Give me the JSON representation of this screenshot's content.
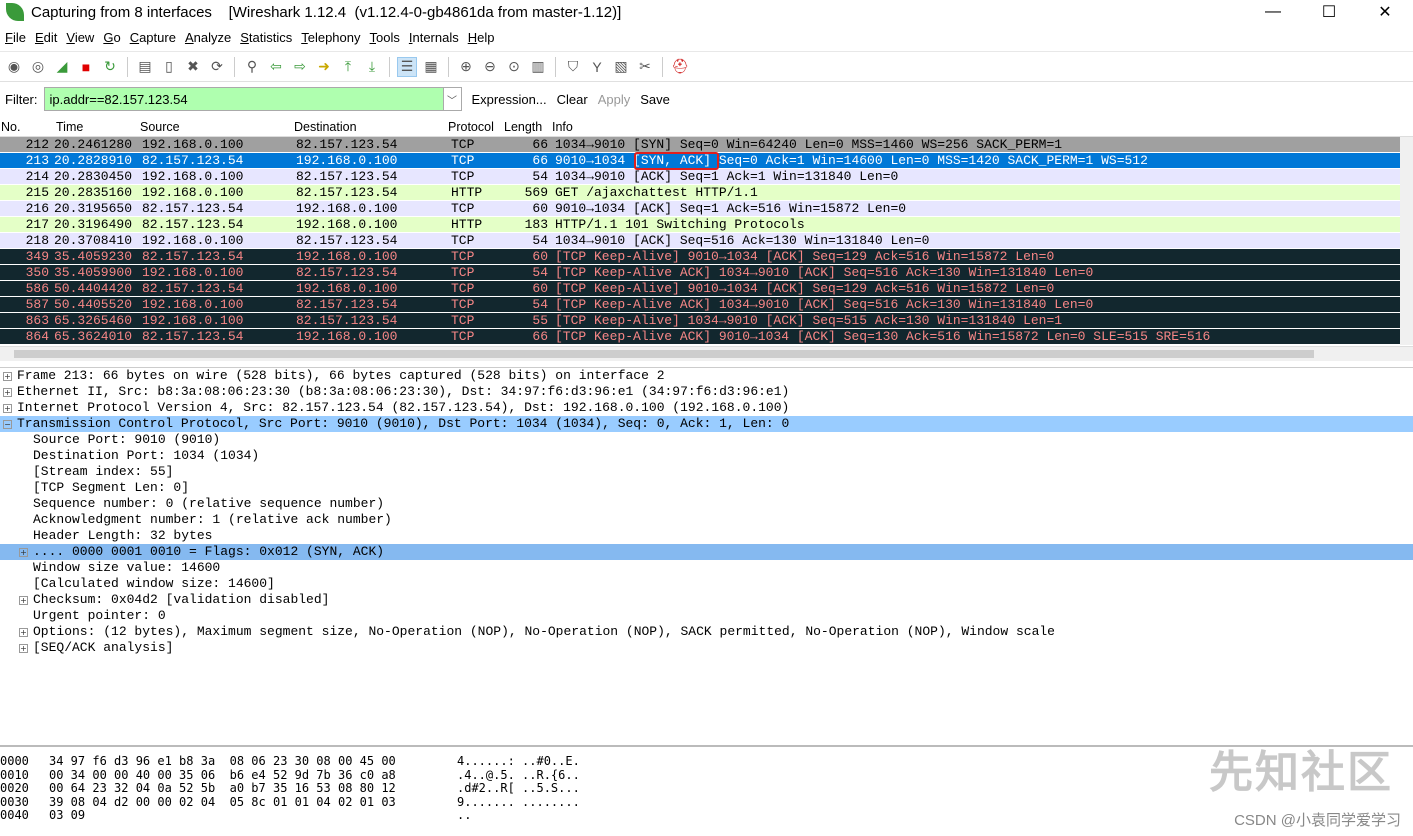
{
  "window": {
    "title": "Capturing from 8 interfaces    [Wireshark 1.12.4  (v1.12.4-0-gb4861da from master-1.12)]"
  },
  "menu": [
    "File",
    "Edit",
    "View",
    "Go",
    "Capture",
    "Analyze",
    "Statistics",
    "Telephony",
    "Tools",
    "Internals",
    "Help"
  ],
  "toolbar": {
    "icons": [
      "interfaces-icon",
      "options-icon",
      "start-capture-icon",
      "stop-capture-icon",
      "restart-capture-icon",
      "|",
      "open-file-icon",
      "save-file-icon",
      "close-file-icon",
      "reload-icon",
      "|",
      "find-icon",
      "back-icon",
      "forward-icon",
      "go-to-packet-icon",
      "first-packet-icon",
      "last-packet-icon",
      "|",
      "colorize-icon",
      "autoscroll-icon",
      "|",
      "zoom-in-icon",
      "zoom-out-icon",
      "normal-size-icon",
      "resize-columns-icon",
      "|",
      "capture-filters-icon",
      "display-filters-icon",
      "coloring-rules-icon",
      "preferences-icon",
      "|",
      "help-icon"
    ]
  },
  "filter": {
    "label": "Filter:",
    "value": "ip.addr==82.157.123.54",
    "expression": "Expression...",
    "clear": "Clear",
    "apply": "Apply",
    "save": "Save"
  },
  "columns": [
    "No.",
    "Time",
    "Source",
    "Destination",
    "Protocol",
    "Length",
    "Info"
  ],
  "colors": {
    "selected": "#0078d7",
    "tcp": "#e7e6ff",
    "http": "#e4ffc7",
    "syn": "#a0a0a0",
    "bad_bg": "#12272e",
    "bad_fg": "#f78787",
    "highlight": "#e0201e"
  },
  "packets": [
    {
      "no": "212",
      "time": "20.2461280",
      "src": "192.168.0.100",
      "dst": "82.157.123.54",
      "proto": "TCP",
      "len": "66",
      "info": "1034→9010 [SYN] Seq=0 Win=64240 Len=0 MSS=1460 WS=256 SACK_PERM=1",
      "style": "syn"
    },
    {
      "no": "213",
      "time": "20.2828910",
      "src": "82.157.123.54",
      "dst": "192.168.0.100",
      "proto": "TCP",
      "len": "66",
      "info": "9010→1034 [SYN, ACK] Seq=0 Ack=1 Win=14600 Len=0 MSS=1420 SACK_PERM=1 WS=512",
      "style": "selected"
    },
    {
      "no": "214",
      "time": "20.2830450",
      "src": "192.168.0.100",
      "dst": "82.157.123.54",
      "proto": "TCP",
      "len": "54",
      "info": "1034→9010 [ACK] Seq=1 Ack=1 Win=131840 Len=0",
      "style": "tcp"
    },
    {
      "no": "215",
      "time": "20.2835160",
      "src": "192.168.0.100",
      "dst": "82.157.123.54",
      "proto": "HTTP",
      "len": "569",
      "info": "GET /ajaxchattest HTTP/1.1",
      "style": "http"
    },
    {
      "no": "216",
      "time": "20.3195650",
      "src": "82.157.123.54",
      "dst": "192.168.0.100",
      "proto": "TCP",
      "len": "60",
      "info": "9010→1034 [ACK] Seq=1 Ack=516 Win=15872 Len=0",
      "style": "tcp"
    },
    {
      "no": "217",
      "time": "20.3196490",
      "src": "82.157.123.54",
      "dst": "192.168.0.100",
      "proto": "HTTP",
      "len": "183",
      "info": "HTTP/1.1 101 Switching Protocols",
      "style": "http"
    },
    {
      "no": "218",
      "time": "20.3708410",
      "src": "192.168.0.100",
      "dst": "82.157.123.54",
      "proto": "TCP",
      "len": "54",
      "info": "1034→9010 [ACK] Seq=516 Ack=130 Win=131840 Len=0",
      "style": "tcp"
    },
    {
      "no": "349",
      "time": "35.4059230",
      "src": "82.157.123.54",
      "dst": "192.168.0.100",
      "proto": "TCP",
      "len": "60",
      "info": "[TCP Keep-Alive] 9010→1034 [ACK] Seq=129 Ack=516 Win=15872 Len=0",
      "style": "bad"
    },
    {
      "no": "350",
      "time": "35.4059900",
      "src": "192.168.0.100",
      "dst": "82.157.123.54",
      "proto": "TCP",
      "len": "54",
      "info": "[TCP Keep-Alive ACK] 1034→9010 [ACK] Seq=516 Ack=130 Win=131840 Len=0",
      "style": "bad"
    },
    {
      "no": "586",
      "time": "50.4404420",
      "src": "82.157.123.54",
      "dst": "192.168.0.100",
      "proto": "TCP",
      "len": "60",
      "info": "[TCP Keep-Alive] 9010→1034 [ACK] Seq=129 Ack=516 Win=15872 Len=0",
      "style": "bad"
    },
    {
      "no": "587",
      "time": "50.4405520",
      "src": "192.168.0.100",
      "dst": "82.157.123.54",
      "proto": "TCP",
      "len": "54",
      "info": "[TCP Keep-Alive ACK] 1034→9010 [ACK] Seq=516 Ack=130 Win=131840 Len=0",
      "style": "bad"
    },
    {
      "no": "863",
      "time": "65.3265460",
      "src": "192.168.0.100",
      "dst": "82.157.123.54",
      "proto": "TCP",
      "len": "55",
      "info": "[TCP Keep-Alive] 1034→9010 [ACK] Seq=515 Ack=130 Win=131840 Len=1",
      "style": "bad"
    },
    {
      "no": "864",
      "time": "65.3624010",
      "src": "82.157.123.54",
      "dst": "192.168.0.100",
      "proto": "TCP",
      "len": "66",
      "info": "[TCP Keep-Alive ACK] 9010→1034 [ACK] Seq=130 Ack=516 Win=15872 Len=0 SLE=515 SRE=516",
      "style": "bad"
    }
  ],
  "details": [
    {
      "text": "Frame 213: 66 bytes on wire (528 bits), 66 bytes captured (528 bits) on interface 2",
      "level": 0,
      "expander": "+"
    },
    {
      "text": "Ethernet II, Src: b8:3a:08:06:23:30 (b8:3a:08:06:23:30), Dst: 34:97:f6:d3:96:e1 (34:97:f6:d3:96:e1)",
      "level": 0,
      "expander": "+"
    },
    {
      "text": "Internet Protocol Version 4, Src: 82.157.123.54 (82.157.123.54), Dst: 192.168.0.100 (192.168.0.100)",
      "level": 0,
      "expander": "+"
    },
    {
      "text": "Transmission Control Protocol, Src Port: 9010 (9010), Dst Port: 1034 (1034), Seq: 0, Ack: 1, Len: 0",
      "level": 0,
      "expander": "-",
      "hl": "#99ccff"
    },
    {
      "text": "Source Port: 9010 (9010)",
      "level": 1
    },
    {
      "text": "Destination Port: 1034 (1034)",
      "level": 1
    },
    {
      "text": "[Stream index: 55]",
      "level": 1
    },
    {
      "text": "[TCP Segment Len: 0]",
      "level": 1
    },
    {
      "text": "Sequence number: 0    (relative sequence number)",
      "level": 1
    },
    {
      "text": "Acknowledgment number: 1    (relative ack number)",
      "level": 1
    },
    {
      "text": "Header Length: 32 bytes",
      "level": 1
    },
    {
      "text": ".... 0000 0001 0010 = Flags: 0x012 (SYN, ACK)",
      "level": 1,
      "expander": "+",
      "hl": "#85b9f0"
    },
    {
      "text": "Window size value: 14600",
      "level": 1
    },
    {
      "text": "[Calculated window size: 14600]",
      "level": 1
    },
    {
      "text": "Checksum: 0x04d2 [validation disabled]",
      "level": 1,
      "expander": "+"
    },
    {
      "text": "Urgent pointer: 0",
      "level": 1
    },
    {
      "text": "Options: (12 bytes), Maximum segment size, No-Operation (NOP), No-Operation (NOP), SACK permitted, No-Operation (NOP), Window scale",
      "level": 1,
      "expander": "+"
    },
    {
      "text": "[SEQ/ACK analysis]",
      "level": 1,
      "expander": "+"
    }
  ],
  "bytes": [
    {
      "off": "0000",
      "hex": "34 97 f6 d3 96 e1 b8 3a  08 06 23 30 08 00 45 00",
      "ascii": "4......: ..#0..E."
    },
    {
      "off": "0010",
      "hex": "00 34 00 00 40 00 35 06  b6 e4 52 9d 7b 36 c0 a8",
      "ascii": ".4..@.5. ..R.{6.."
    },
    {
      "off": "0020",
      "hex": "00 64 23 32 04 0a 52 5b  a0 b7 35 16 53 08 80 12",
      "ascii": ".d#2..R[ ..5.S..."
    },
    {
      "off": "0030",
      "hex": "39 08 04 d2 00 00 02 04  05 8c 01 01 04 02 01 03",
      "ascii": "9....... ........"
    },
    {
      "off": "0040",
      "hex": "03 09",
      "ascii": ".."
    }
  ],
  "watermark": {
    "main": "先知社区",
    "credit": "CSDN @小袁同学爱学习"
  }
}
